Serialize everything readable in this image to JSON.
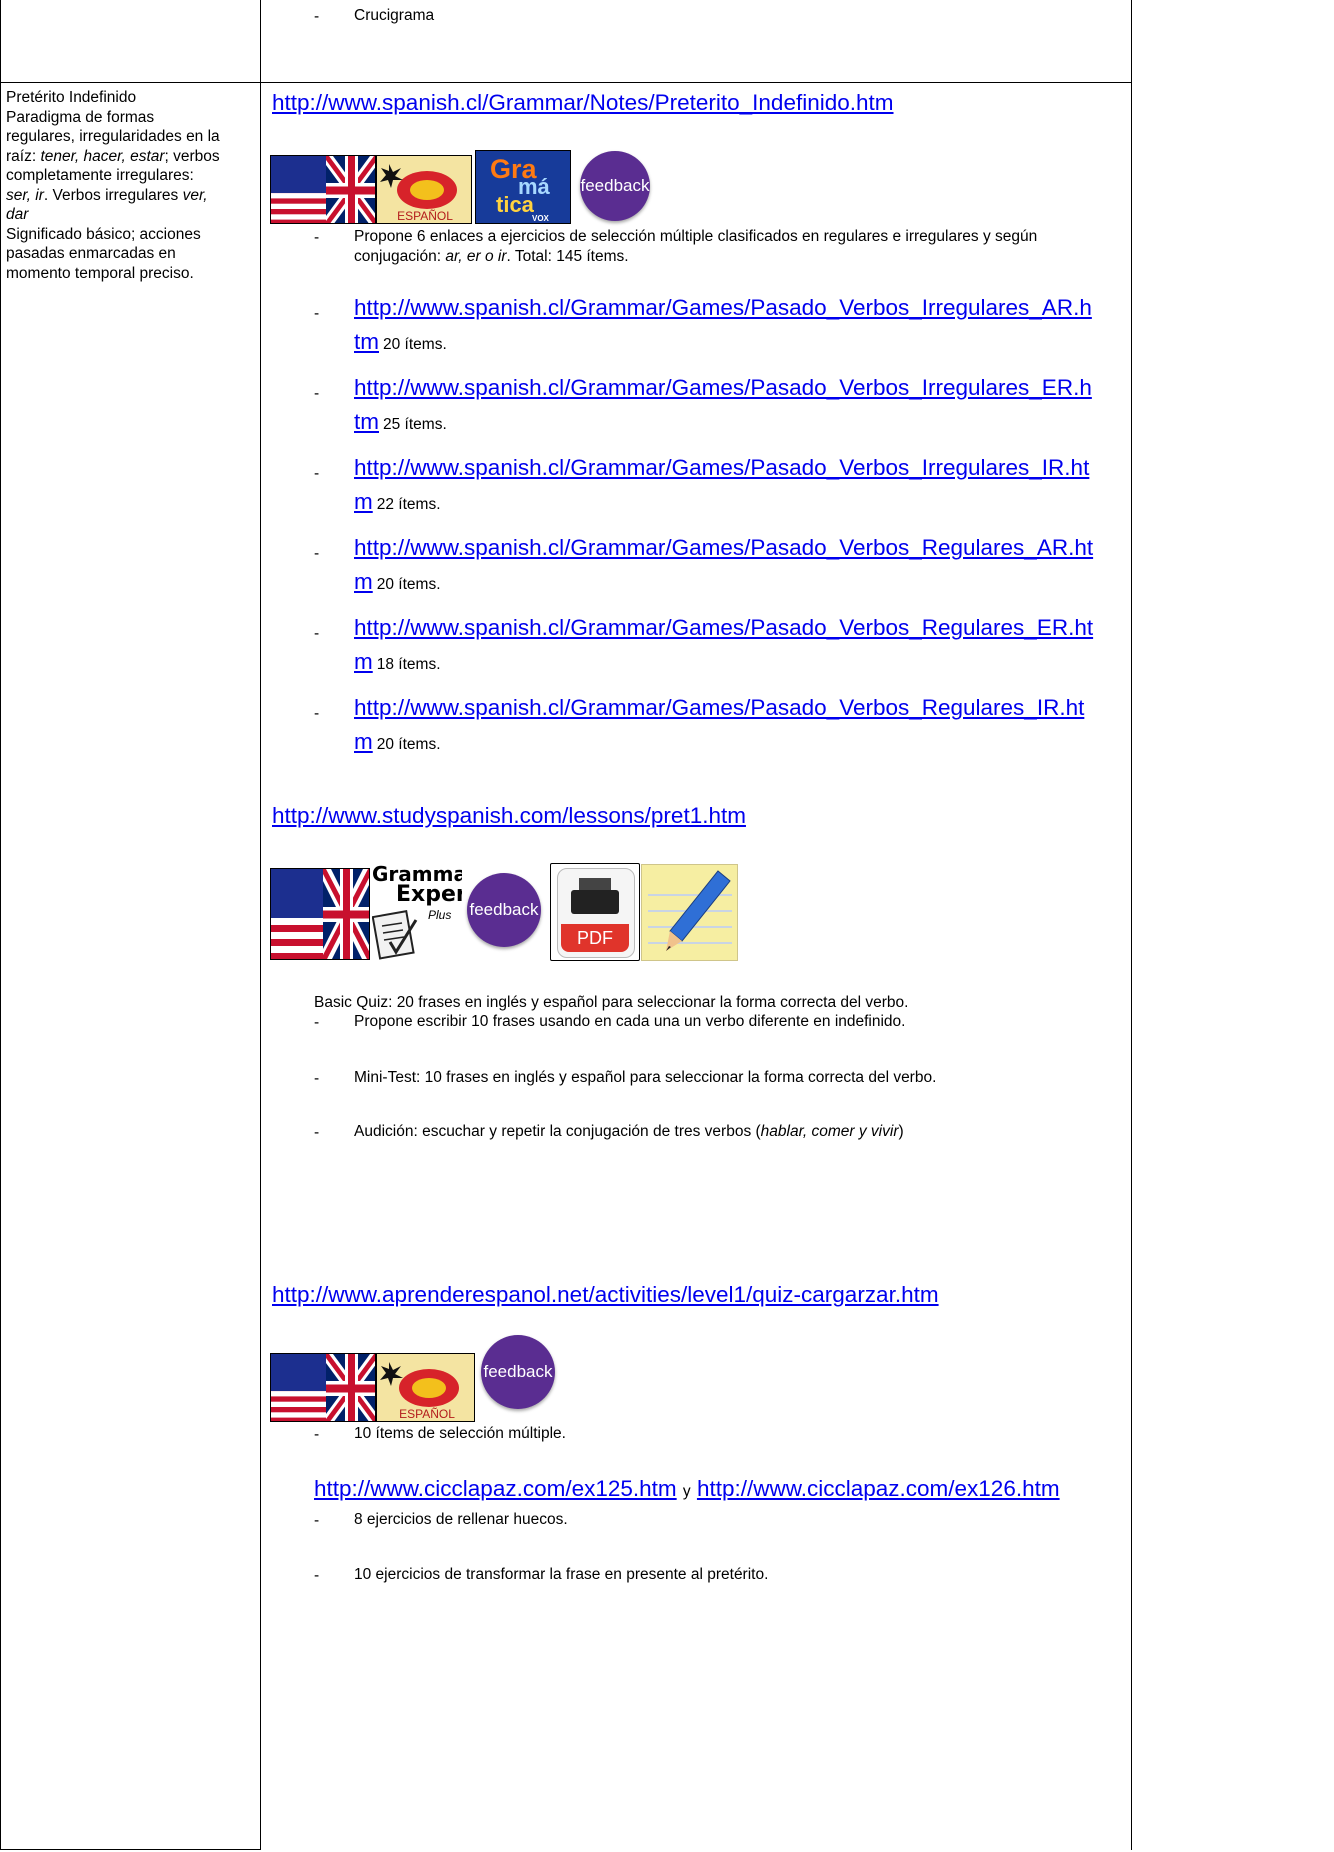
{
  "top_row": {
    "item": "Crucigrama"
  },
  "left_column": {
    "title": "Pretérito Indefinido",
    "line1": "Paradigma de formas",
    "line2": "regulares, irregularidades en la",
    "line3_prefix": "raíz: ",
    "line3_italic": "tener, hacer, estar",
    "line3_suffix": "; verbos",
    "line4": "completamente irregulares:",
    "line5_italic": "ser, ir",
    "line5_mid": ". Verbos irregulares ",
    "line5_italic2": "ver,",
    "line6_italic": "dar",
    "line7": "Significado básico; acciones",
    "line8": "pasadas enmarcadas en",
    "line9": "momento temporal preciso."
  },
  "section1": {
    "url": "http://www.spanish.cl/Grammar/Notes/Preterito_Indefinido.htm",
    "icons": [
      "uk-us-flag-icon",
      "espanol-icon",
      "gramatica-vox-icon",
      "feedback-icon"
    ],
    "icon_text": {
      "espanol": "ESPAÑOL",
      "gramatica_line1": "Gra",
      "gramatica_line2": "má",
      "gramatica_line3": "tica",
      "gramatica_brand": "VOX",
      "feedback": "feedback"
    },
    "desc_line1": "Propone 6 enlaces a ejercicios de selección múltiple clasificados en regulares e irregulares y según",
    "desc_line2_prefix": "conjugación: ",
    "desc_line2_italic": "ar, er o ir",
    "desc_line2_suffix": ".  Total: 145 ítems.",
    "links": [
      {
        "url": "http://www.spanish.cl/Grammar/Games/Pasado_Verbos_Irregulares_AR.htm",
        "line1": "http://www.spanish.cl/Grammar/Games/Pasado_Verbos_Irregulares_AR.h",
        "line2": "tm",
        "count": "20 ítems."
      },
      {
        "url": "http://www.spanish.cl/Grammar/Games/Pasado_Verbos_Irregulares_ER.htm",
        "line1": "http://www.spanish.cl/Grammar/Games/Pasado_Verbos_Irregulares_ER.h",
        "line2": "tm",
        "count": "25 ítems."
      },
      {
        "url": "http://www.spanish.cl/Grammar/Games/Pasado_Verbos_Irregulares_IR.htm",
        "line1": "http://www.spanish.cl/Grammar/Games/Pasado_Verbos_Irregulares_IR.ht",
        "line2": "m",
        "count": "22 ítems."
      },
      {
        "url": "http://www.spanish.cl/Grammar/Games/Pasado_Verbos_Regulares_AR.htm",
        "line1": "http://www.spanish.cl/Grammar/Games/Pasado_Verbos_Regulares_AR.ht",
        "line2": "m",
        "count": "20 ítems."
      },
      {
        "url": "http://www.spanish.cl/Grammar/Games/Pasado_Verbos_Regulares_ER.htm",
        "line1": "http://www.spanish.cl/Grammar/Games/Pasado_Verbos_Regulares_ER.ht",
        "line2": "m",
        "count": "18 ítems."
      },
      {
        "url": "http://www.spanish.cl/Grammar/Games/Pasado_Verbos_Regulares_IR.htm",
        "line1": "http://www.spanish.cl/Grammar/Games/Pasado_Verbos_Regulares_IR.ht",
        "line2": "m",
        "count": "20 ítems."
      }
    ]
  },
  "section2": {
    "url": "http://www.studyspanish.com/lessons/pret1.htm",
    "icons": [
      "uk-us-flag-icon",
      "grammar-expert-plus-icon",
      "feedback-icon",
      "pdf-printer-icon",
      "notepad-pencil-icon"
    ],
    "icon_text": {
      "expert_line1": "Grammar",
      "expert_line2": "Expert",
      "expert_line3": "Plus",
      "feedback": "feedback",
      "pdf": "PDF"
    },
    "basic_quiz": "Basic Quiz: 20 frases en inglés y español para seleccionar la forma correcta del verbo.",
    "item1": "Propone escribir 10 frases usando en cada una un verbo diferente en indefinido.",
    "item2": "Mini-Test: 10 frases en inglés y español para seleccionar la forma correcta del verbo.",
    "item3_prefix": "Audición: escuchar y repetir la conjugación de tres verbos (",
    "item3_italic": "hablar, comer y vivir",
    "item3_suffix": ")"
  },
  "section3": {
    "url": "http://www.aprenderespanol.net/activities/level1/quiz-cargarzar.htm",
    "icons": [
      "uk-us-flag-icon",
      "espanol-icon",
      "feedback-icon"
    ],
    "icon_text": {
      "espanol": "ESPAÑOL",
      "feedback": "feedback"
    },
    "item1": "10 ítems de selección múltiple."
  },
  "section4": {
    "url1": "http://www.cicclapaz.com/ex125.htm",
    "joiner": "y",
    "url2": "http://www.cicclapaz.com/ex126.htm",
    "item1": "8 ejercicios de rellenar huecos.",
    "item2": "10 ejercicios de transformar la frase en presente al pretérito."
  },
  "dash": "-",
  "colors": {
    "link": "#0000ee",
    "feedback_purple": "#5a2d91",
    "flag_red": "#c8102e",
    "flag_blue": "#012169"
  }
}
